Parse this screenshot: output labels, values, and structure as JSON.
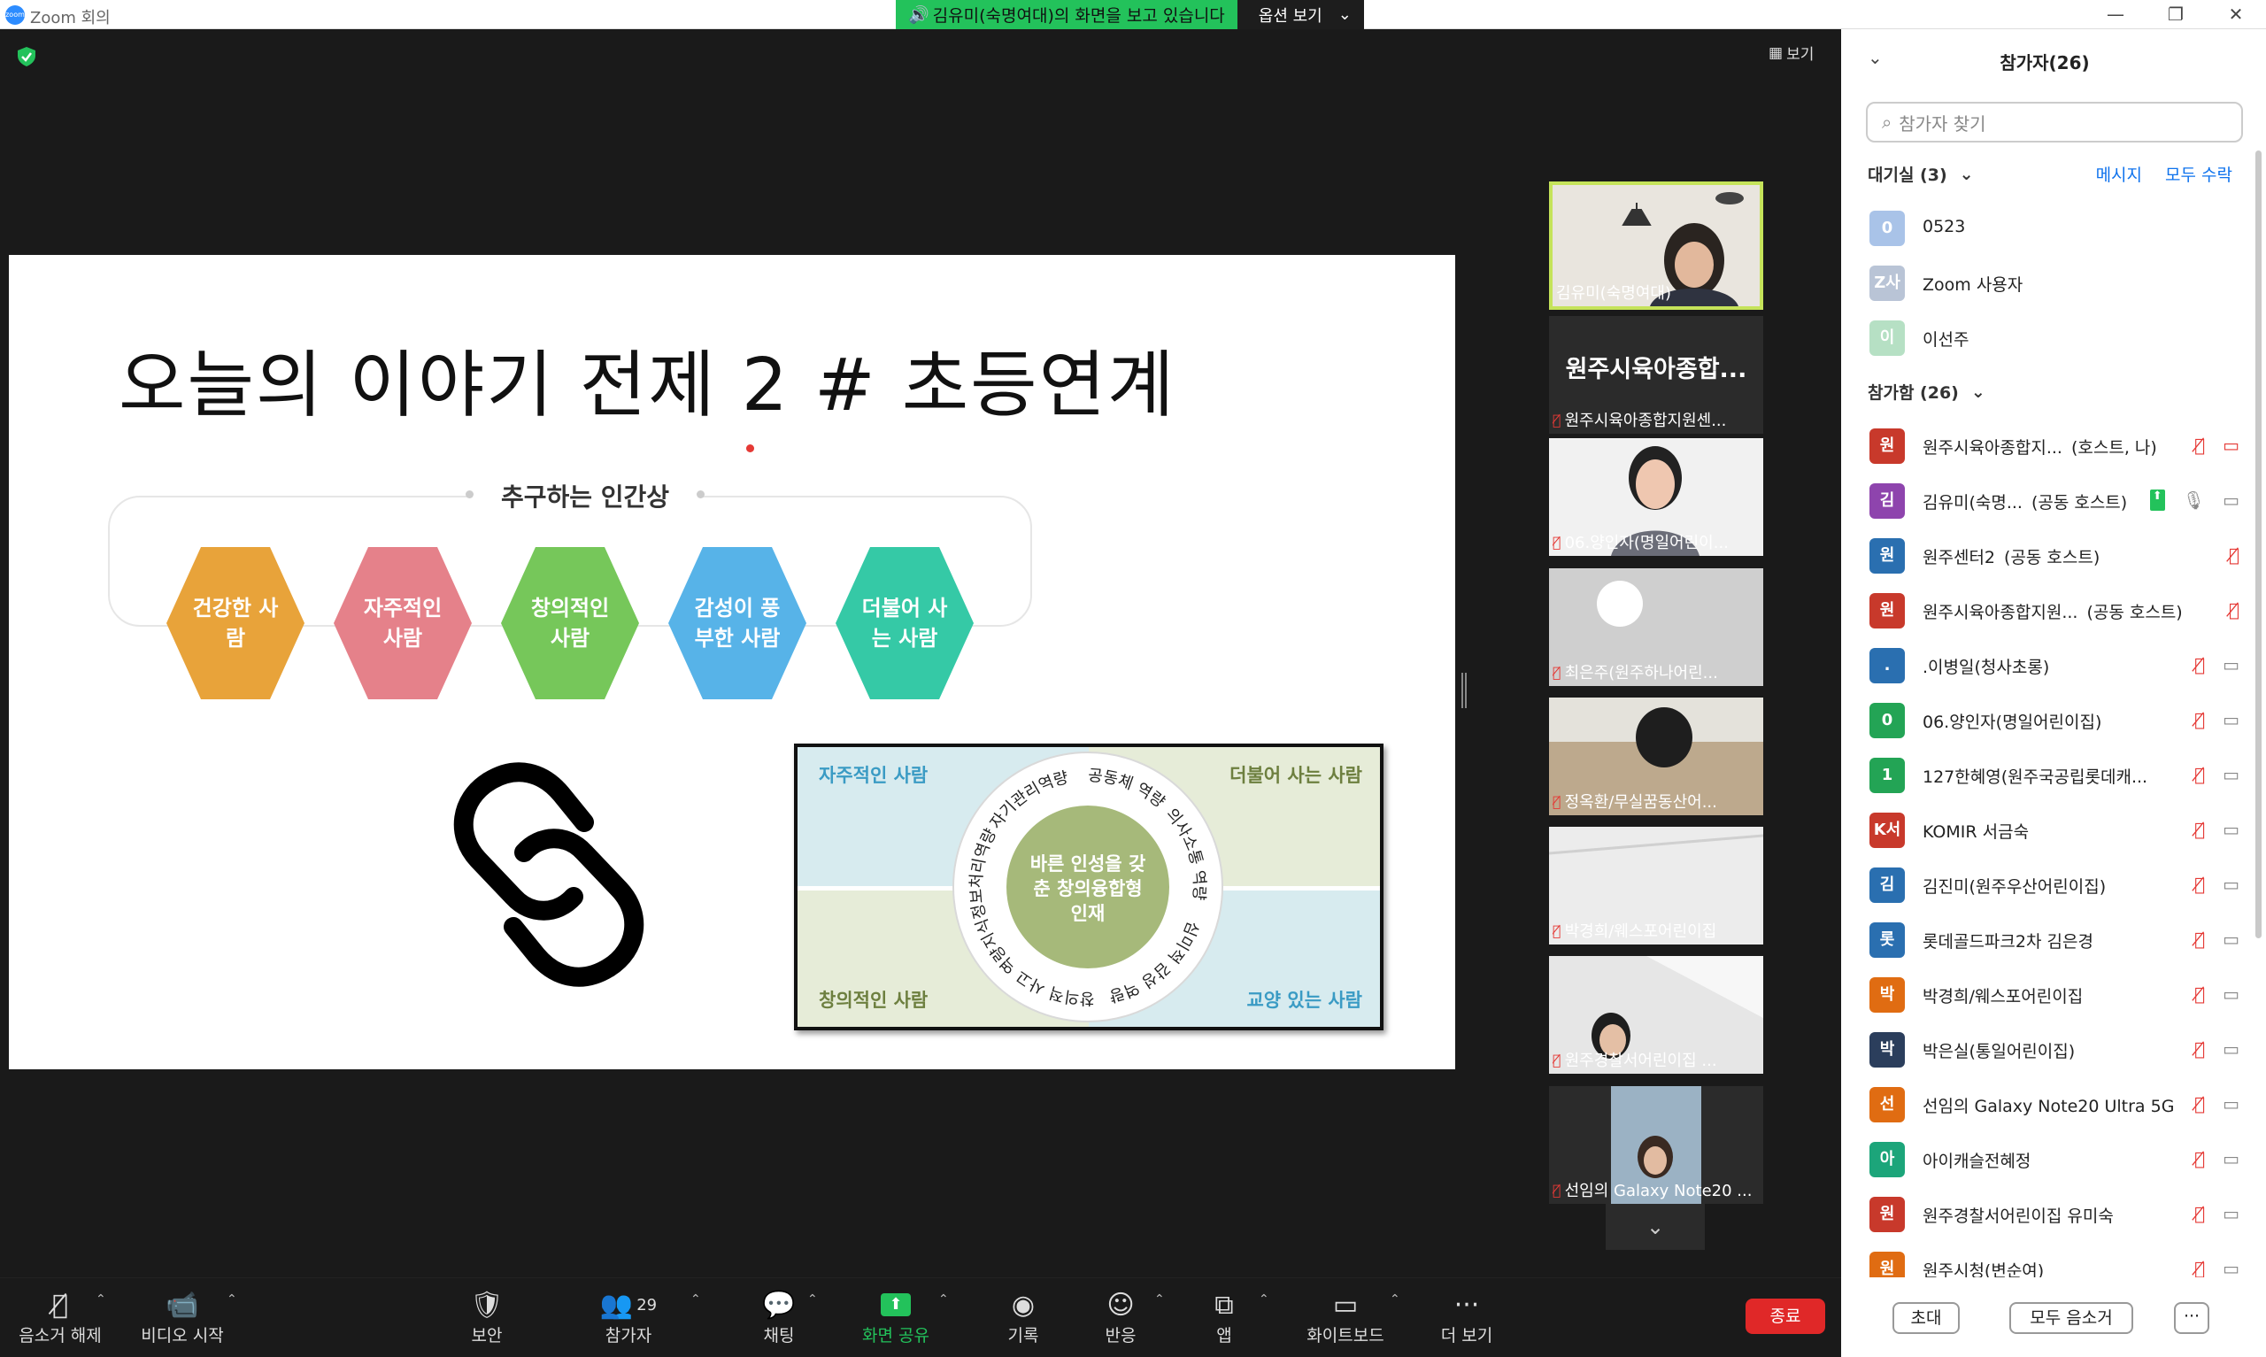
{
  "window": {
    "title": "Zoom 회의",
    "logo_text": "zoom",
    "controls": [
      "—",
      "❐",
      "✕"
    ]
  },
  "share_banner": {
    "message": "김유미(숙명여대)의 화면을 보고 있습니다",
    "options_label": "옵션 보기"
  },
  "view_button": "보기",
  "slide": {
    "title": "오늘의 이야기 전제 2 # 초등연계",
    "frame_label": "추구하는 인간상",
    "traits": [
      {
        "label": "건강한 사람",
        "color": "#e8a33a"
      },
      {
        "label": "자주적인 사람",
        "color": "#e5818a"
      },
      {
        "label": "창의적인 사람",
        "color": "#76c75a"
      },
      {
        "label": "감성이 풍부한 사람",
        "color": "#57b3e8"
      },
      {
        "label": "더불어 사는 사람",
        "color": "#35c9a6"
      }
    ],
    "diagram": {
      "top_left": "자주적인 사람",
      "top_right": "더불어 사는 사람",
      "bottom_left": "창의적인 사람",
      "bottom_right": "교양 있는 사람",
      "center": "바른 인성을 갖춘 창의융합형 인재",
      "ring": [
        "공동체 역량",
        "의사소통 역량",
        "심미적 감성 역량",
        "창의적 사고 역량",
        "지식정보처리역량",
        "자기관리역량"
      ]
    }
  },
  "videos": [
    {
      "name": "김유미(숙명여대)",
      "active": true,
      "muted": false
    },
    {
      "name": "원주시육아종합지원센...",
      "big_label": "원주시육아종합...",
      "muted": true
    },
    {
      "name": "06.양인자(명일어린이...",
      "muted": true
    },
    {
      "name": "최은주(원주하나어린...",
      "muted": true
    },
    {
      "name": "정옥환/무실꿈동산어...",
      "muted": true
    },
    {
      "name": "박경희/웨스포어린이집",
      "muted": true
    },
    {
      "name": "원주경찰서어린이집 ...",
      "muted": true
    },
    {
      "name": "선임의 Galaxy Note20 ...",
      "muted": true
    }
  ],
  "toolbar": {
    "unmute": "음소거 해제",
    "video": "비디오 시작",
    "security": "보안",
    "participants": "참가자",
    "participant_count": "29",
    "chat": "채팅",
    "share": "화면 공유",
    "record": "기록",
    "reactions": "반응",
    "apps": "앱",
    "whiteboard": "화이트보드",
    "more": "더 보기",
    "end": "종료"
  },
  "panel": {
    "title": "참가자(26)",
    "search_placeholder": "참가자 찾기",
    "waiting_label": "대기실 (3)",
    "message_link": "메시지",
    "admit_all_link": "모두 수락",
    "waiting": [
      {
        "initial": "0",
        "name": "0523",
        "color": "#a9c3e8"
      },
      {
        "initial": "Z사",
        "name": "Zoom 사용자",
        "color": "#b9c4d6"
      },
      {
        "initial": "이",
        "name": "이선주",
        "color": "#b6e0c4"
      }
    ],
    "in_meeting_label": "참가함 (26)",
    "participants": [
      {
        "initial": "원",
        "name": "원주시육아종합지...",
        "role": "(호스트, 나)",
        "color": "#c8392b",
        "muted": true,
        "cam": "off"
      },
      {
        "initial": "김",
        "name": "김유미(숙명...",
        "role": "(공동 호스트)",
        "color": "#8e44ad",
        "muted": false,
        "cam": "on",
        "sharing": true
      },
      {
        "initial": "원",
        "name": "원주센터2",
        "role": "(공동 호스트)",
        "color": "#2a6fb0",
        "muted": true,
        "cam": "none"
      },
      {
        "initial": "원",
        "name": "원주시육아종합지원...",
        "role": "(공동 호스트)",
        "color": "#c8392b",
        "muted": true,
        "cam": "none"
      },
      {
        "initial": ".",
        "name": ".이병일(청사초롱)",
        "role": "",
        "color": "#2a6fb0",
        "muted": true,
        "cam": "on"
      },
      {
        "initial": "0",
        "name": "06.양인자(명일어린이집)",
        "role": "",
        "color": "#23a455",
        "muted": true,
        "cam": "on"
      },
      {
        "initial": "1",
        "name": "127한혜영(원주국공립롯데캐...",
        "role": "",
        "color": "#23a455",
        "muted": true,
        "cam": "on"
      },
      {
        "initial": "K서",
        "name": "KOMIR 서금숙",
        "role": "",
        "color": "#c8392b",
        "muted": true,
        "cam": "on"
      },
      {
        "initial": "김",
        "name": "김진미(원주우산어린이집)",
        "role": "",
        "color": "#2a6fb0",
        "muted": true,
        "cam": "on"
      },
      {
        "initial": "롯",
        "name": "롯데골드파크2차 김은경",
        "role": "",
        "color": "#2a6fb0",
        "muted": true,
        "cam": "on"
      },
      {
        "initial": "박",
        "name": "박경희/웨스포어린이집",
        "role": "",
        "color": "#e06c12",
        "muted": true,
        "cam": "on"
      },
      {
        "initial": "박",
        "name": "박은실(통일어린이집)",
        "role": "",
        "color": "#2b3e5c",
        "muted": true,
        "cam": "on"
      },
      {
        "initial": "선",
        "name": "선임의 Galaxy Note20 Ultra 5G",
        "role": "",
        "color": "#e06c12",
        "muted": true,
        "cam": "on"
      },
      {
        "initial": "아",
        "name": "아이캐슬전혜정",
        "role": "",
        "color": "#1ca57a",
        "muted": true,
        "cam": "on"
      },
      {
        "initial": "원",
        "name": "원주경찰서어린이집 유미숙",
        "role": "",
        "color": "#c8392b",
        "muted": true,
        "cam": "on"
      },
      {
        "initial": "원",
        "name": "원주시청(변순여)",
        "role": "",
        "color": "#e06c12",
        "muted": true,
        "cam": "on"
      }
    ],
    "invite": "초대",
    "mute_all": "모두 음소거",
    "more": "···"
  }
}
